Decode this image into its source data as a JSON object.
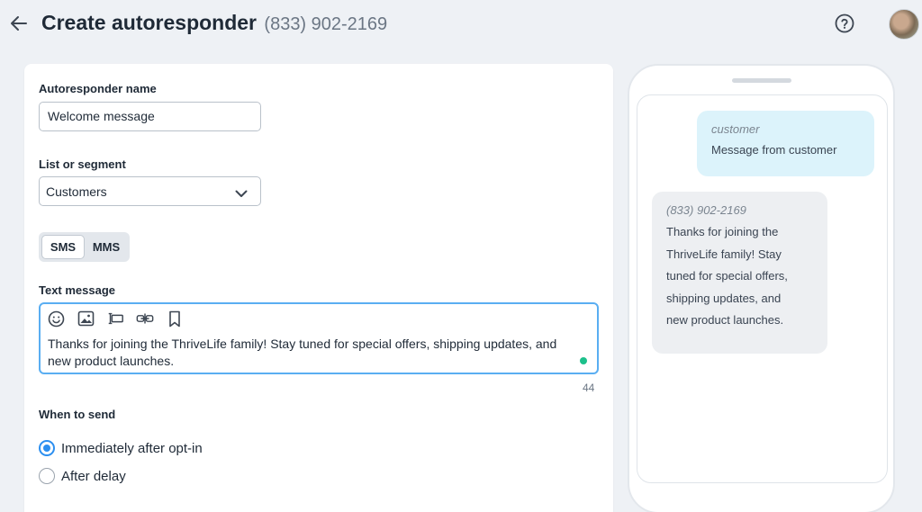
{
  "header": {
    "title": "Create autoresponder",
    "phone": "(833) 902-2169"
  },
  "form": {
    "name_label": "Autoresponder name",
    "name_value": "Welcome message",
    "list_label": "List or segment",
    "list_value": "Customers",
    "channel_tabs": [
      {
        "label": "SMS",
        "active": true
      },
      {
        "label": "MMS",
        "active": false
      }
    ],
    "message_label": "Text message",
    "message_text": "Thanks for joining the ThriveLife family! Stay tuned for special offers, shipping updates, and new product launches.",
    "char_count": "44",
    "when_label": "When to send",
    "send_options": [
      {
        "label": "Immediately after opt-in",
        "checked": true
      },
      {
        "label": "After delay",
        "checked": false
      }
    ]
  },
  "preview": {
    "customer_sender": "customer",
    "customer_message": "Message from customer",
    "business_sender": "(833) 902-2169",
    "business_message_lines": [
      "Thanks for joining the",
      "ThriveLife family! Stay",
      "tuned for special offers,",
      "shipping updates, and",
      "new product launches."
    ]
  },
  "colors": {
    "accent": "#2c8ff0",
    "focus_border": "#5aaef2",
    "status_dot": "#1cc08b",
    "outgoing_bubble": "#dcf3fb",
    "incoming_bubble": "#edeff2"
  }
}
